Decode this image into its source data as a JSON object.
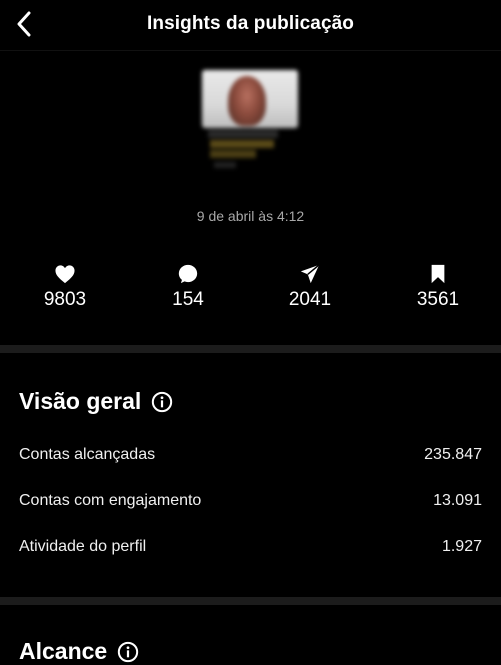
{
  "header": {
    "title": "Insights da publicação"
  },
  "post": {
    "date": "9 de abril às 4:12"
  },
  "stats": [
    {
      "icon": "heart-icon",
      "value": "9803"
    },
    {
      "icon": "comment-icon",
      "value": "154"
    },
    {
      "icon": "share-icon",
      "value": "2041"
    },
    {
      "icon": "bookmark-icon",
      "value": "3561"
    }
  ],
  "overview": {
    "title": "Visão geral",
    "rows": [
      {
        "label": "Contas alcançadas",
        "value": "235.847"
      },
      {
        "label": "Contas com engajamento",
        "value": "13.091"
      },
      {
        "label": "Atividade do perfil",
        "value": "1.927"
      }
    ]
  },
  "reach": {
    "title": "Alcance"
  },
  "colors": {
    "background": "#000000",
    "divider": "#1c1c1c",
    "secondary_text": "#a8a8a8"
  }
}
